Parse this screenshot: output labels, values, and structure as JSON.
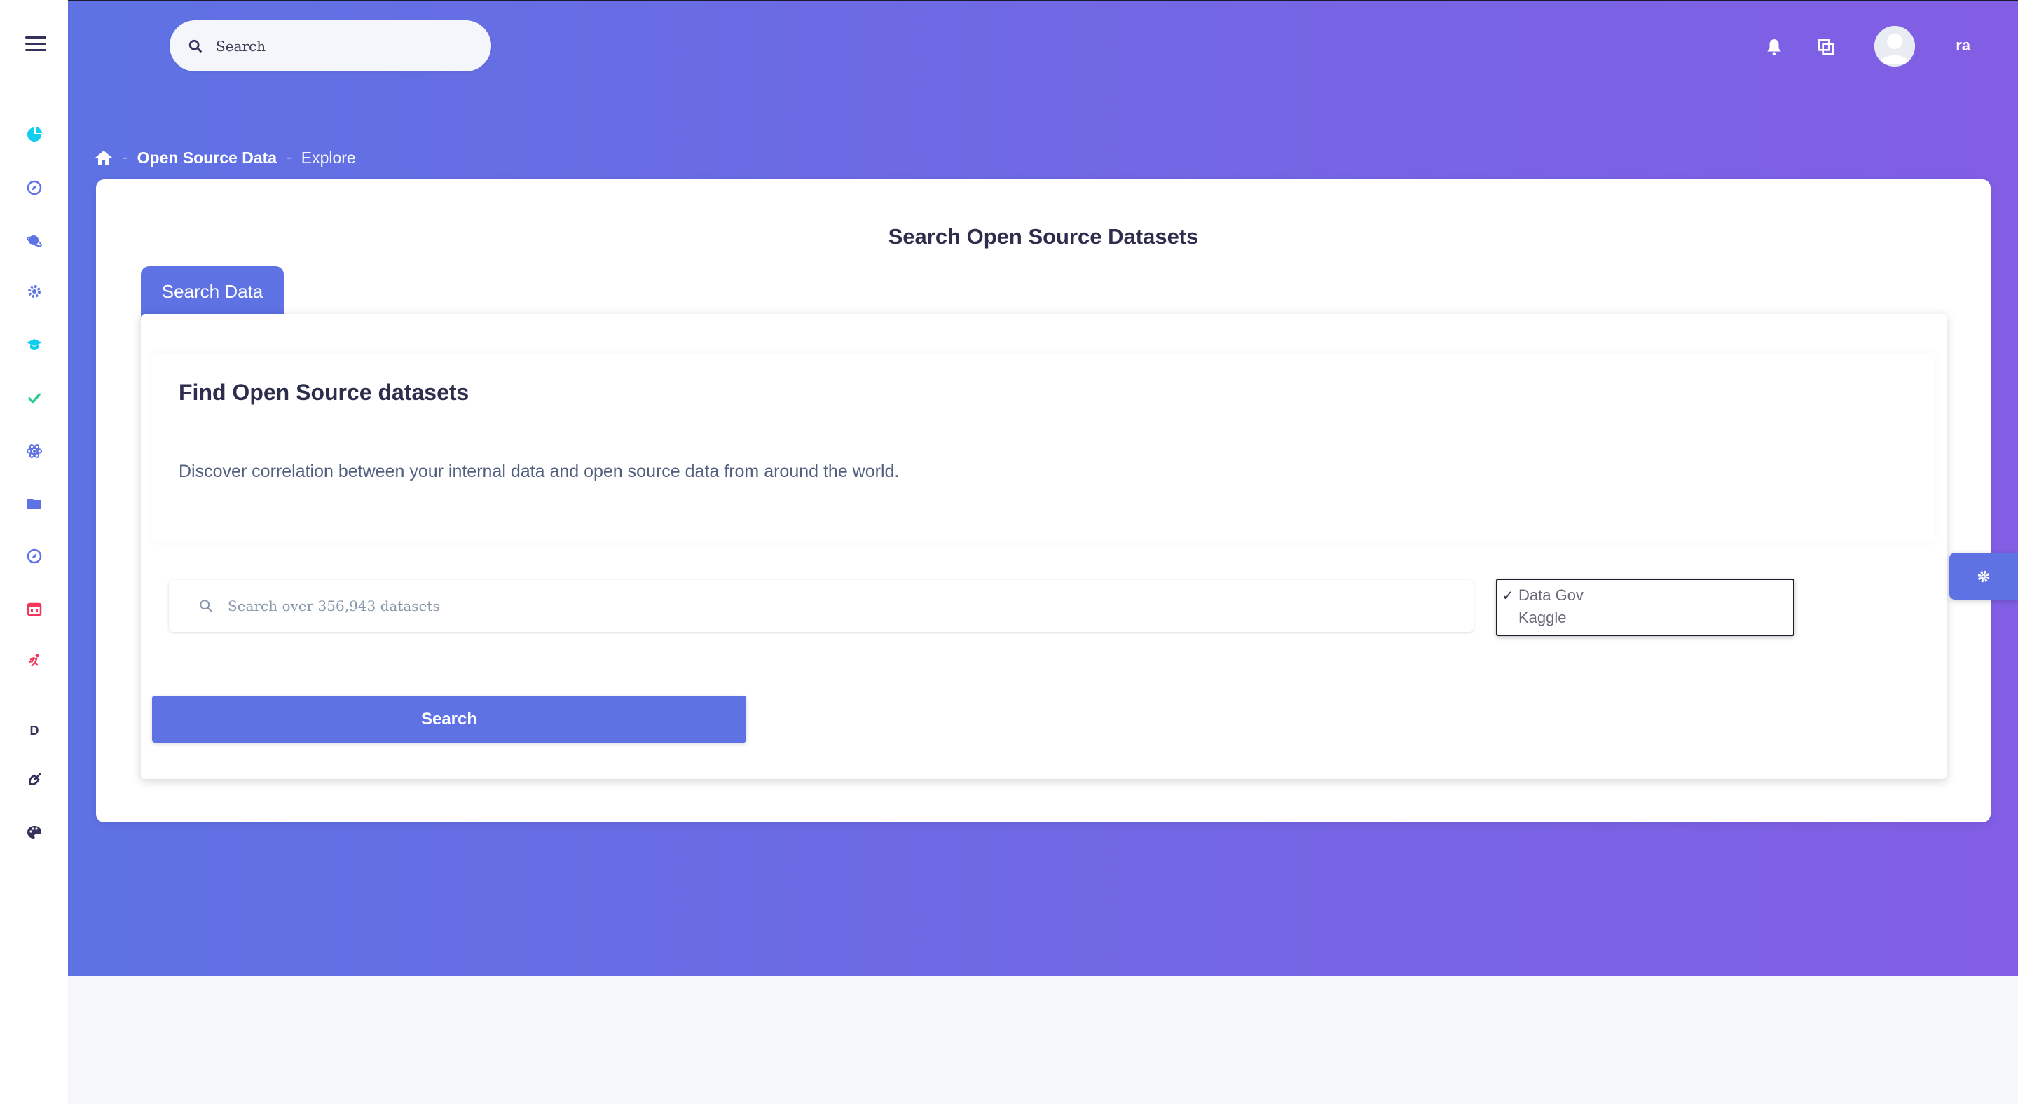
{
  "header": {
    "search_placeholder": "Search",
    "user_name": "ra"
  },
  "sidebar": {
    "items": [
      {
        "icon": "pie-chart-icon",
        "color": "#11cdef"
      },
      {
        "icon": "compass-icon",
        "color": "#5e72e4"
      },
      {
        "icon": "planet-icon",
        "color": "#5e72e4"
      },
      {
        "icon": "gear-icon",
        "color": "#5e72e4"
      },
      {
        "icon": "graduation-cap-icon",
        "color": "#11cdef"
      },
      {
        "icon": "check-icon",
        "color": "#2dce89"
      },
      {
        "icon": "atom-icon",
        "color": "#5e72e4"
      },
      {
        "icon": "folder-icon",
        "color": "#5e72e4"
      },
      {
        "icon": "compass-icon",
        "color": "#5e72e4"
      },
      {
        "icon": "calendar-icon",
        "color": "#f5365c"
      },
      {
        "icon": "running-icon",
        "color": "#f5365c"
      }
    ],
    "letter_item": "D",
    "bottom_items": [
      {
        "icon": "satellite-icon",
        "color": "#32325d"
      },
      {
        "icon": "palette-icon",
        "color": "#32325d"
      }
    ]
  },
  "breadcrumb": {
    "items": [
      "Open Source Data",
      "Explore"
    ]
  },
  "page": {
    "title": "Search Open Source Datasets",
    "tab_label": "Search Data",
    "card_title": "Find Open Source datasets",
    "card_text": "Discover correlation between your internal data and open source data from around the world.",
    "dataset_search_placeholder": "Search over 356,943 datasets",
    "sources": [
      {
        "label": "Data Gov",
        "selected": true
      },
      {
        "label": "Kaggle",
        "selected": false
      }
    ],
    "search_button": "Search"
  },
  "colors": {
    "primary": "#5e72e4",
    "gradient_end": "#825ee4"
  }
}
